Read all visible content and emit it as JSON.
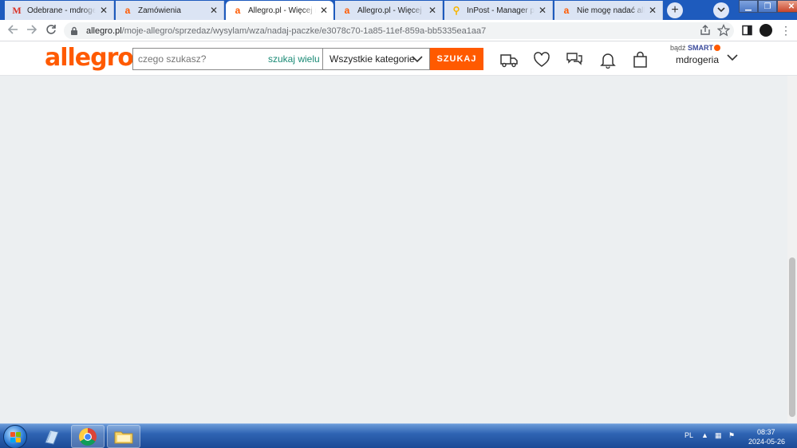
{
  "tabs": [
    {
      "title": "Odebrane - mdrogeria@",
      "favicon": "gmail-icon",
      "active": false
    },
    {
      "title": "Zamówienia",
      "favicon": "allegro-icon",
      "active": false
    },
    {
      "title": "Allegro.pl - Więcej niż aukcje",
      "favicon": "allegro-icon",
      "active": true
    },
    {
      "title": "Allegro.pl - Więcej niż aukcje",
      "favicon": "allegro-icon",
      "active": false
    },
    {
      "title": "InPost - Manager paczek",
      "favicon": "inpost-icon",
      "active": false
    },
    {
      "title": "Nie mogę nadać allegro",
      "favicon": "allegro-icon",
      "active": false
    }
  ],
  "tab_close_glyph": "✕",
  "new_tab_glyph": "+",
  "address_bar": {
    "host": "allegro.pl",
    "path": "/moje-allegro/sprzedaz/wysylam/wza/nadaj-paczke/e3078c70-1a85-11ef-859a-bb5335ea1aa7"
  },
  "site": {
    "logo_text": "allegro",
    "search_placeholder": "czego szukasz?",
    "search_many_label": "szukaj wielu",
    "category_label": "Wszystkie kategorie",
    "search_button_label": "SZUKAJ",
    "smart_prefix": "bądź",
    "smart_label": "SMART",
    "username": "mdrogeria"
  },
  "taskbar": {
    "language": "PL",
    "time": "08:37",
    "date": "2024-05-26"
  },
  "colors": {
    "brand": "#ff5a00",
    "page_background": "#eceff1",
    "tabstrip": "#1e5bbd"
  }
}
